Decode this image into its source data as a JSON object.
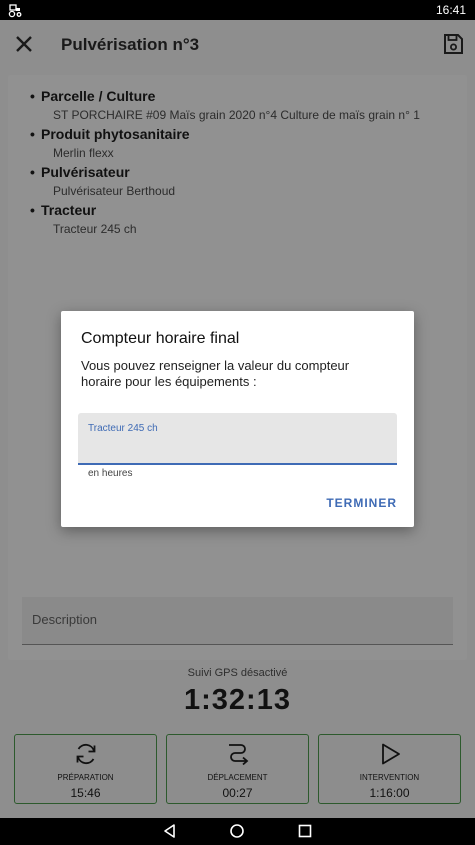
{
  "status_bar": {
    "time": "16:41"
  },
  "app_bar": {
    "title": "Pulvérisation n°3"
  },
  "details": [
    {
      "title": "Parcelle / Culture",
      "value": "ST PORCHAIRE #09 Maïs grain 2020 n°4 Culture de maïs grain n° 1"
    },
    {
      "title": "Produit phytosanitaire",
      "value": "Merlin flexx"
    },
    {
      "title": "Pulvérisateur",
      "value": "Pulvérisateur Berthoud"
    },
    {
      "title": "Tracteur",
      "value": "Tracteur 245 ch"
    }
  ],
  "description": {
    "label": "Description"
  },
  "timer": {
    "gps_status": "Suivi GPS désactivé",
    "elapsed": "1:32:13"
  },
  "stages": [
    {
      "label": "PRÉPARATION",
      "time": "15:46",
      "icon": "refresh-icon"
    },
    {
      "label": "DÉPLACEMENT",
      "time": "00:27",
      "icon": "route-icon"
    },
    {
      "label": "INTERVENTION",
      "time": "1:16:00",
      "icon": "play-icon"
    }
  ],
  "dialog": {
    "title": "Compteur horaire final",
    "message": "Vous pouvez renseigner la valeur du compteur horaire pour les équipements :",
    "field_label": "Tracteur 245 ch",
    "field_value": "",
    "field_helper": "en heures",
    "terminate_label": "TERMINER"
  },
  "colors": {
    "accent": "#3f6bb5",
    "stage_border": "#2d5a2d",
    "scrim": "#8e8e8e"
  }
}
